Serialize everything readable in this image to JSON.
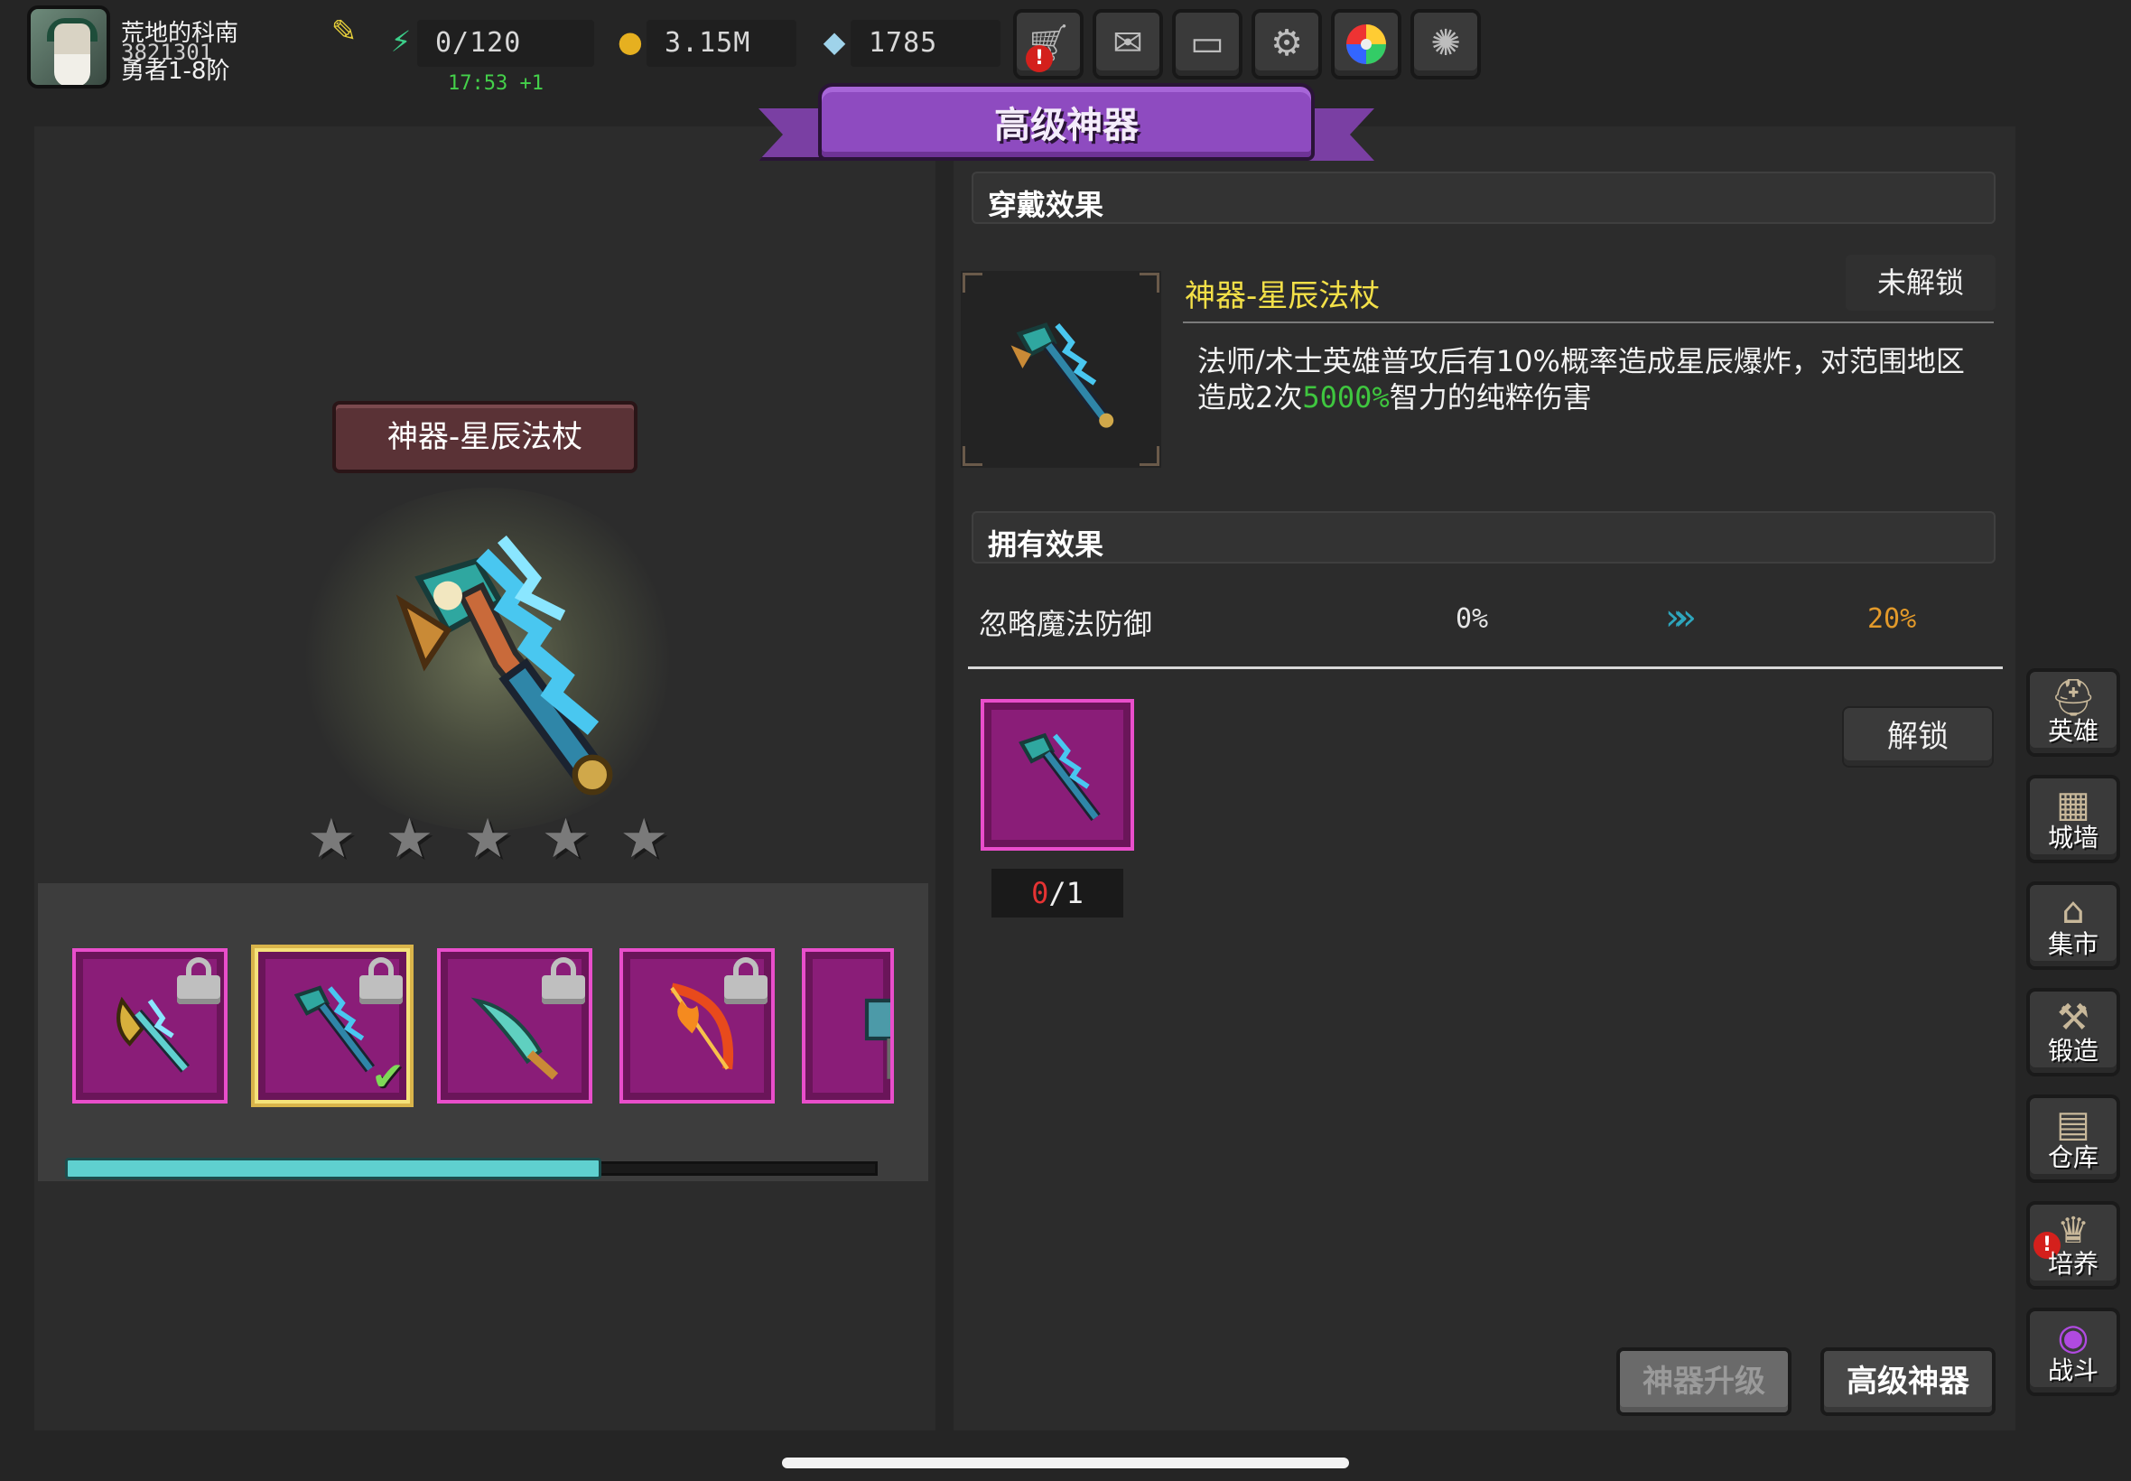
{
  "player": {
    "name": "荒地的科南",
    "id": "3821301",
    "rank": "勇者1-8阶"
  },
  "resources": {
    "energy": "0/120",
    "energy_timer": "17:53 +1",
    "gold": "3.15M",
    "gems": "1785"
  },
  "top_buttons": [
    {
      "name": "shop-button",
      "icon": "cart-icon",
      "alert": true
    },
    {
      "name": "mail-button",
      "icon": "mail-icon",
      "alert": false
    },
    {
      "name": "gamepad-button",
      "icon": "gamepad-icon",
      "alert": false
    },
    {
      "name": "settings-button",
      "icon": "gear-icon",
      "alert": false
    },
    {
      "name": "lucky-wheel-button",
      "icon": "color-wheel-icon",
      "alert": false
    },
    {
      "name": "event-button",
      "icon": "fireworks-icon",
      "alert": false
    }
  ],
  "title": "高级神器",
  "artifact": {
    "name": "神器-星辰法杖",
    "stars": 5,
    "status": "未解锁"
  },
  "sections": {
    "wear_effect": "穿戴效果",
    "own_effect": "拥有效果"
  },
  "description": {
    "part1": "法师/术士英雄普攻后有10%概率造成星辰爆炸，对范围地区造成2次",
    "highlight": "5000%",
    "part2": "智力的纯粹伤害"
  },
  "stat": {
    "name": "忽略魔法防御",
    "from": "0%",
    "to": "20%"
  },
  "material": {
    "have": "0",
    "rest": "/1"
  },
  "buttons": {
    "unlock": "解锁",
    "tab_upgrade": "神器升级",
    "tab_advanced": "高级神器"
  },
  "carousel": {
    "scroll_fraction": 0.66,
    "items": [
      {
        "name": "artifact-slot-axe",
        "locked": true,
        "selected": false
      },
      {
        "name": "artifact-slot-star-staff",
        "locked": true,
        "selected": true
      },
      {
        "name": "artifact-slot-blade",
        "locked": true,
        "selected": false
      },
      {
        "name": "artifact-slot-fire-bow",
        "locked": true,
        "selected": false
      },
      {
        "name": "artifact-slot-hammer",
        "locked": false,
        "selected": false
      }
    ]
  },
  "nav": [
    {
      "label": "英雄",
      "icon": "helmet-icon"
    },
    {
      "label": "城墙",
      "icon": "wall-icon"
    },
    {
      "label": "集市",
      "icon": "market-icon"
    },
    {
      "label": "锻造",
      "icon": "anvil-icon"
    },
    {
      "label": "仓库",
      "icon": "warehouse-icon"
    },
    {
      "label": "培养",
      "icon": "trophy-icon",
      "alert": true
    },
    {
      "label": "战斗",
      "icon": "portal-icon"
    }
  ],
  "colors": {
    "banner_purple": "#8e4bc0",
    "slot_magenta": "#8a1d78",
    "item_name_yellow": "#f3e048",
    "highlight_green": "#3fc63f",
    "stat_orange": "#e39a2a"
  }
}
